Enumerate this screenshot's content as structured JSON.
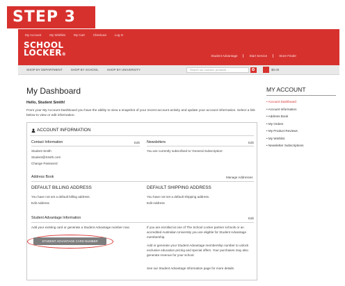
{
  "step_label": "STEP 3",
  "header": {
    "top_links": [
      "My Account",
      "My Wishlist",
      "My Cart",
      "Checkout",
      "Log In"
    ],
    "logo_line1": "SCHOOL",
    "logo_line2": "LOCKER",
    "right_links": [
      "Student Advantage",
      "Start Service",
      "Store Finder"
    ],
    "brand_color": "#d7312e"
  },
  "nav": {
    "items": [
      "SHOP BY DEPARTMENT",
      "SHOP BY SCHOOL",
      "SHOP BY UNIVERSITY"
    ],
    "search_placeholder": "Search our courses, products ...",
    "cart_total": "$0.00"
  },
  "dashboard": {
    "title": "My Dashboard",
    "greeting": "Hello, Student Smith!",
    "intro": "From your My Account Dashboard you have the ability to view a snapshot of your recent account activity and update your account information. Select a link below to view or edit information.",
    "account_info_heading": "ACCOUNT INFORMATION",
    "contact": {
      "heading": "Contact Information",
      "edit": "Edit",
      "name": "Student Smith",
      "email": "Student@Smith.com",
      "change_password": "Change Password"
    },
    "newsletters": {
      "heading": "Newsletters",
      "edit": "Edit",
      "text": "You are currently subscribed to 'General Subscription'."
    },
    "address_book": {
      "heading": "Address Book",
      "manage": "Manage Addresses"
    },
    "billing": {
      "heading": "DEFAULT BILLING ADDRESS",
      "text": "You have not set a default billing address.",
      "edit": "Edit Address"
    },
    "shipping": {
      "heading": "DEFAULT SHIPPING ADDRESS",
      "text": "You have not set a default shipping address.",
      "edit": "Edit Address"
    },
    "student_advantage": {
      "heading": "Student Advantage Information",
      "edit": "Edit",
      "left_text": "Add your existing card or generate a Student Advantage number now.",
      "button": "STUDENT ADVANTAGE CARD NUMBER",
      "right_p1": "If you are enrolled at one of The School Locker partner schools or an accredited Australian University you are eligible for Student Advantage membership.",
      "right_p2": "Add or generate your Student Advantage membership number to unlock exclusive education pricing and special offers. Your purchases may also generate revenue for your school.",
      "right_p3": "See our Student Advantage Information page for more details."
    }
  },
  "sidebar": {
    "title": "MY ACCOUNT",
    "items": [
      {
        "label": "Account Dashboard",
        "active": true
      },
      {
        "label": "Account Information"
      },
      {
        "label": "Address Book"
      },
      {
        "label": "My Orders"
      },
      {
        "label": "My Product Reviews"
      },
      {
        "label": "My Wishlist"
      },
      {
        "label": "Newsletter Subscriptions"
      }
    ]
  }
}
